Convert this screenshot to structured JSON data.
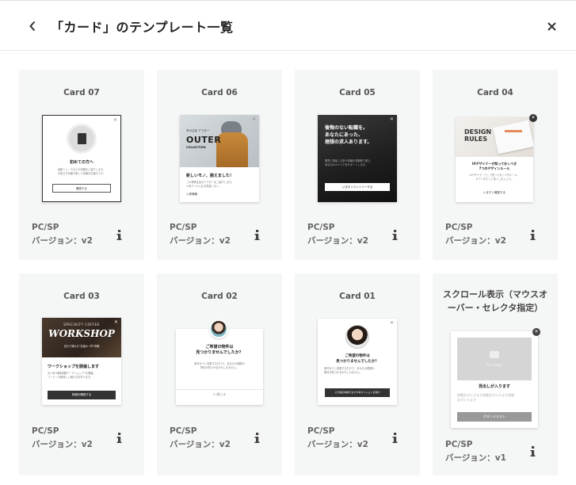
{
  "header": {
    "title": "「カード」のテンプレート一覧"
  },
  "cards": [
    {
      "name": "Card 07",
      "device": "PC/SP",
      "version": "バージョン：v2",
      "preview": {
        "heading": "初めての方へ",
        "body": "最新ニュースなどの情報をご紹介します。\nお役立ち情報や新しい情報をお届けです。",
        "button": "確認する"
      }
    },
    {
      "name": "Card 06",
      "device": "PC/SP",
      "version": "バージョン：v2",
      "preview": {
        "brand_small": "冬の注目 アウター",
        "brand": "OUTER",
        "brand_sub": "COLLECTION",
        "heading": "新しいモノ、揃えました！",
        "body": "この季節注目のアウターをご紹介します。\n人気アイテムをお見逃しなく。",
        "link": "入荷情報"
      }
    },
    {
      "name": "Card 05",
      "device": "PC/SP",
      "version": "バージョン：v2",
      "preview": {
        "headline": "後悔のない転職を。\nあなたにあった、\n理想の求人あります。",
        "body": "業界に特化した求人情報を多数取り揃え、\nあなたのキャリアをサポートします。",
        "button": "いますぐエントリーする"
      }
    },
    {
      "name": "Card 04",
      "device": "PC/SP",
      "version": "バージョン：v2",
      "preview": {
        "brand": "DESIGN\nRULES",
        "heading": "UIデザイナーが知っておくべき\n7つのデザインルール",
        "body": "UIデザイナーとして知っておくべきルール。\nサイトをもっと良くしましょう。",
        "link": "いますぐ確認する"
      }
    },
    {
      "name": "Card 03",
      "device": "PC/SP",
      "version": "バージョン：v2",
      "preview": {
        "brand_small": "SPECIALTY COFFEE",
        "brand": "WORKSHOP",
        "banner_sub": "自分で淹れる“至福の一杯”体験",
        "heading": "ワークショップを開催します",
        "body": "大人気“珈琲体験ワークショップ”を開催。\nコーヒーの美味しい淹れ方を学べます。",
        "button": "詳細を確認する"
      }
    },
    {
      "name": "Card 02",
      "device": "PC/SP",
      "version": "バージョン：v2",
      "preview": {
        "heading": "ご希望の物件は\n見つかりませんでしたか？",
        "body": "条件を少し変更するだけで、あなたの理想の\n物件が見つかるかもしれません。",
        "link": "閉じる"
      }
    },
    {
      "name": "Card 01",
      "device": "PC/SP",
      "version": "バージョン：v2",
      "preview": {
        "heading": "ご希望の物件は\n見つかりませんでしたか？",
        "body": "条件を少し変更するだけで、あなたの理想の\n物件が見つかるかもしれません。",
        "button": "その他の地域でおすすめマンションを探す"
      }
    },
    {
      "name": "スクロール表示（マウスオーバー・セレクタ指定）",
      "device": "PC/SP",
      "version": "バージョン：v1",
      "preview": {
        "image_label": "No image",
        "heading": "見出しが入ります",
        "body": "詳細文が入ります詳細文が入ります詳細\n文が入ります",
        "button": "ボタンテキスト"
      }
    }
  ]
}
